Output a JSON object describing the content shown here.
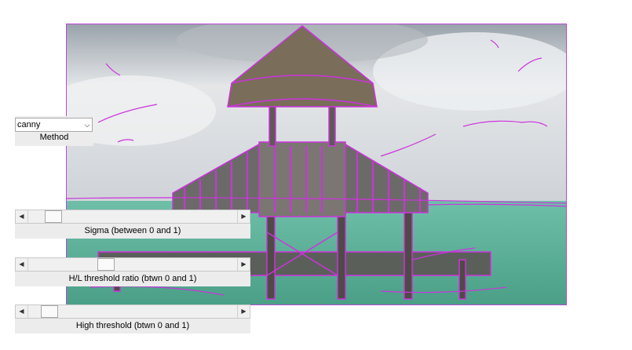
{
  "method": {
    "selected": "canny",
    "label": "Method"
  },
  "sliders": [
    {
      "label": "Sigma (between 0 and 1)",
      "value": 0.09
    },
    {
      "label": "H/L threshold ratio (btwn 0 and 1)",
      "value": 0.36
    },
    {
      "label": "High threshold (btwn 0 and 1)",
      "value": 0.07
    }
  ],
  "image": {
    "subject": "beach gazebo pier over water",
    "edge_color": "#cc33dd"
  }
}
